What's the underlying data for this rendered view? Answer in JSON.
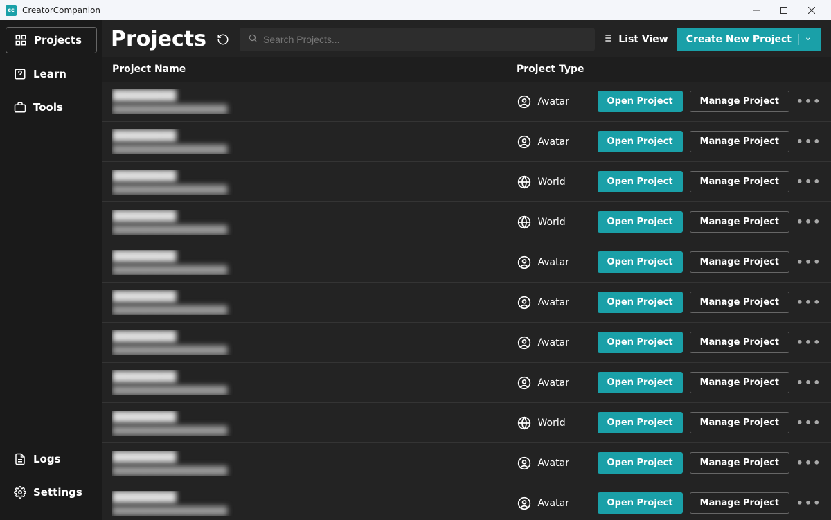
{
  "window": {
    "title": "CreatorCompanion"
  },
  "sidebar": {
    "items": [
      {
        "label": "Projects",
        "active": true,
        "icon": "grid-icon"
      },
      {
        "label": "Learn",
        "active": false,
        "icon": "help-icon"
      },
      {
        "label": "Tools",
        "active": false,
        "icon": "toolbox-icon"
      }
    ],
    "bottom": [
      {
        "label": "Logs",
        "icon": "document-icon"
      },
      {
        "label": "Settings",
        "icon": "gear-icon"
      }
    ]
  },
  "header": {
    "title": "Projects",
    "search_placeholder": "Search Projects...",
    "list_view_label": "List View",
    "create_label": "Create New Project"
  },
  "columns": {
    "name": "Project Name",
    "type": "Project Type"
  },
  "buttons": {
    "open": "Open Project",
    "manage": "Manage Project"
  },
  "projects": [
    {
      "name": "████████",
      "path": "██████████████████",
      "type": "Avatar"
    },
    {
      "name": "████████",
      "path": "██████████████████",
      "type": "Avatar"
    },
    {
      "name": "████████",
      "path": "██████████████████",
      "type": "World"
    },
    {
      "name": "████████",
      "path": "██████████████████",
      "type": "World"
    },
    {
      "name": "████████",
      "path": "██████████████████",
      "type": "Avatar"
    },
    {
      "name": "████████",
      "path": "██████████████████",
      "type": "Avatar"
    },
    {
      "name": "████████",
      "path": "██████████████████",
      "type": "Avatar"
    },
    {
      "name": "████████",
      "path": "██████████████████",
      "type": "Avatar"
    },
    {
      "name": "████████",
      "path": "██████████████████",
      "type": "World"
    },
    {
      "name": "████████",
      "path": "██████████████████",
      "type": "Avatar"
    },
    {
      "name": "████████",
      "path": "██████████████████",
      "type": "Avatar"
    }
  ],
  "colors": {
    "accent": "#1aa0a8",
    "bg": "#232323",
    "sidebar_bg": "#1a1a1a"
  }
}
